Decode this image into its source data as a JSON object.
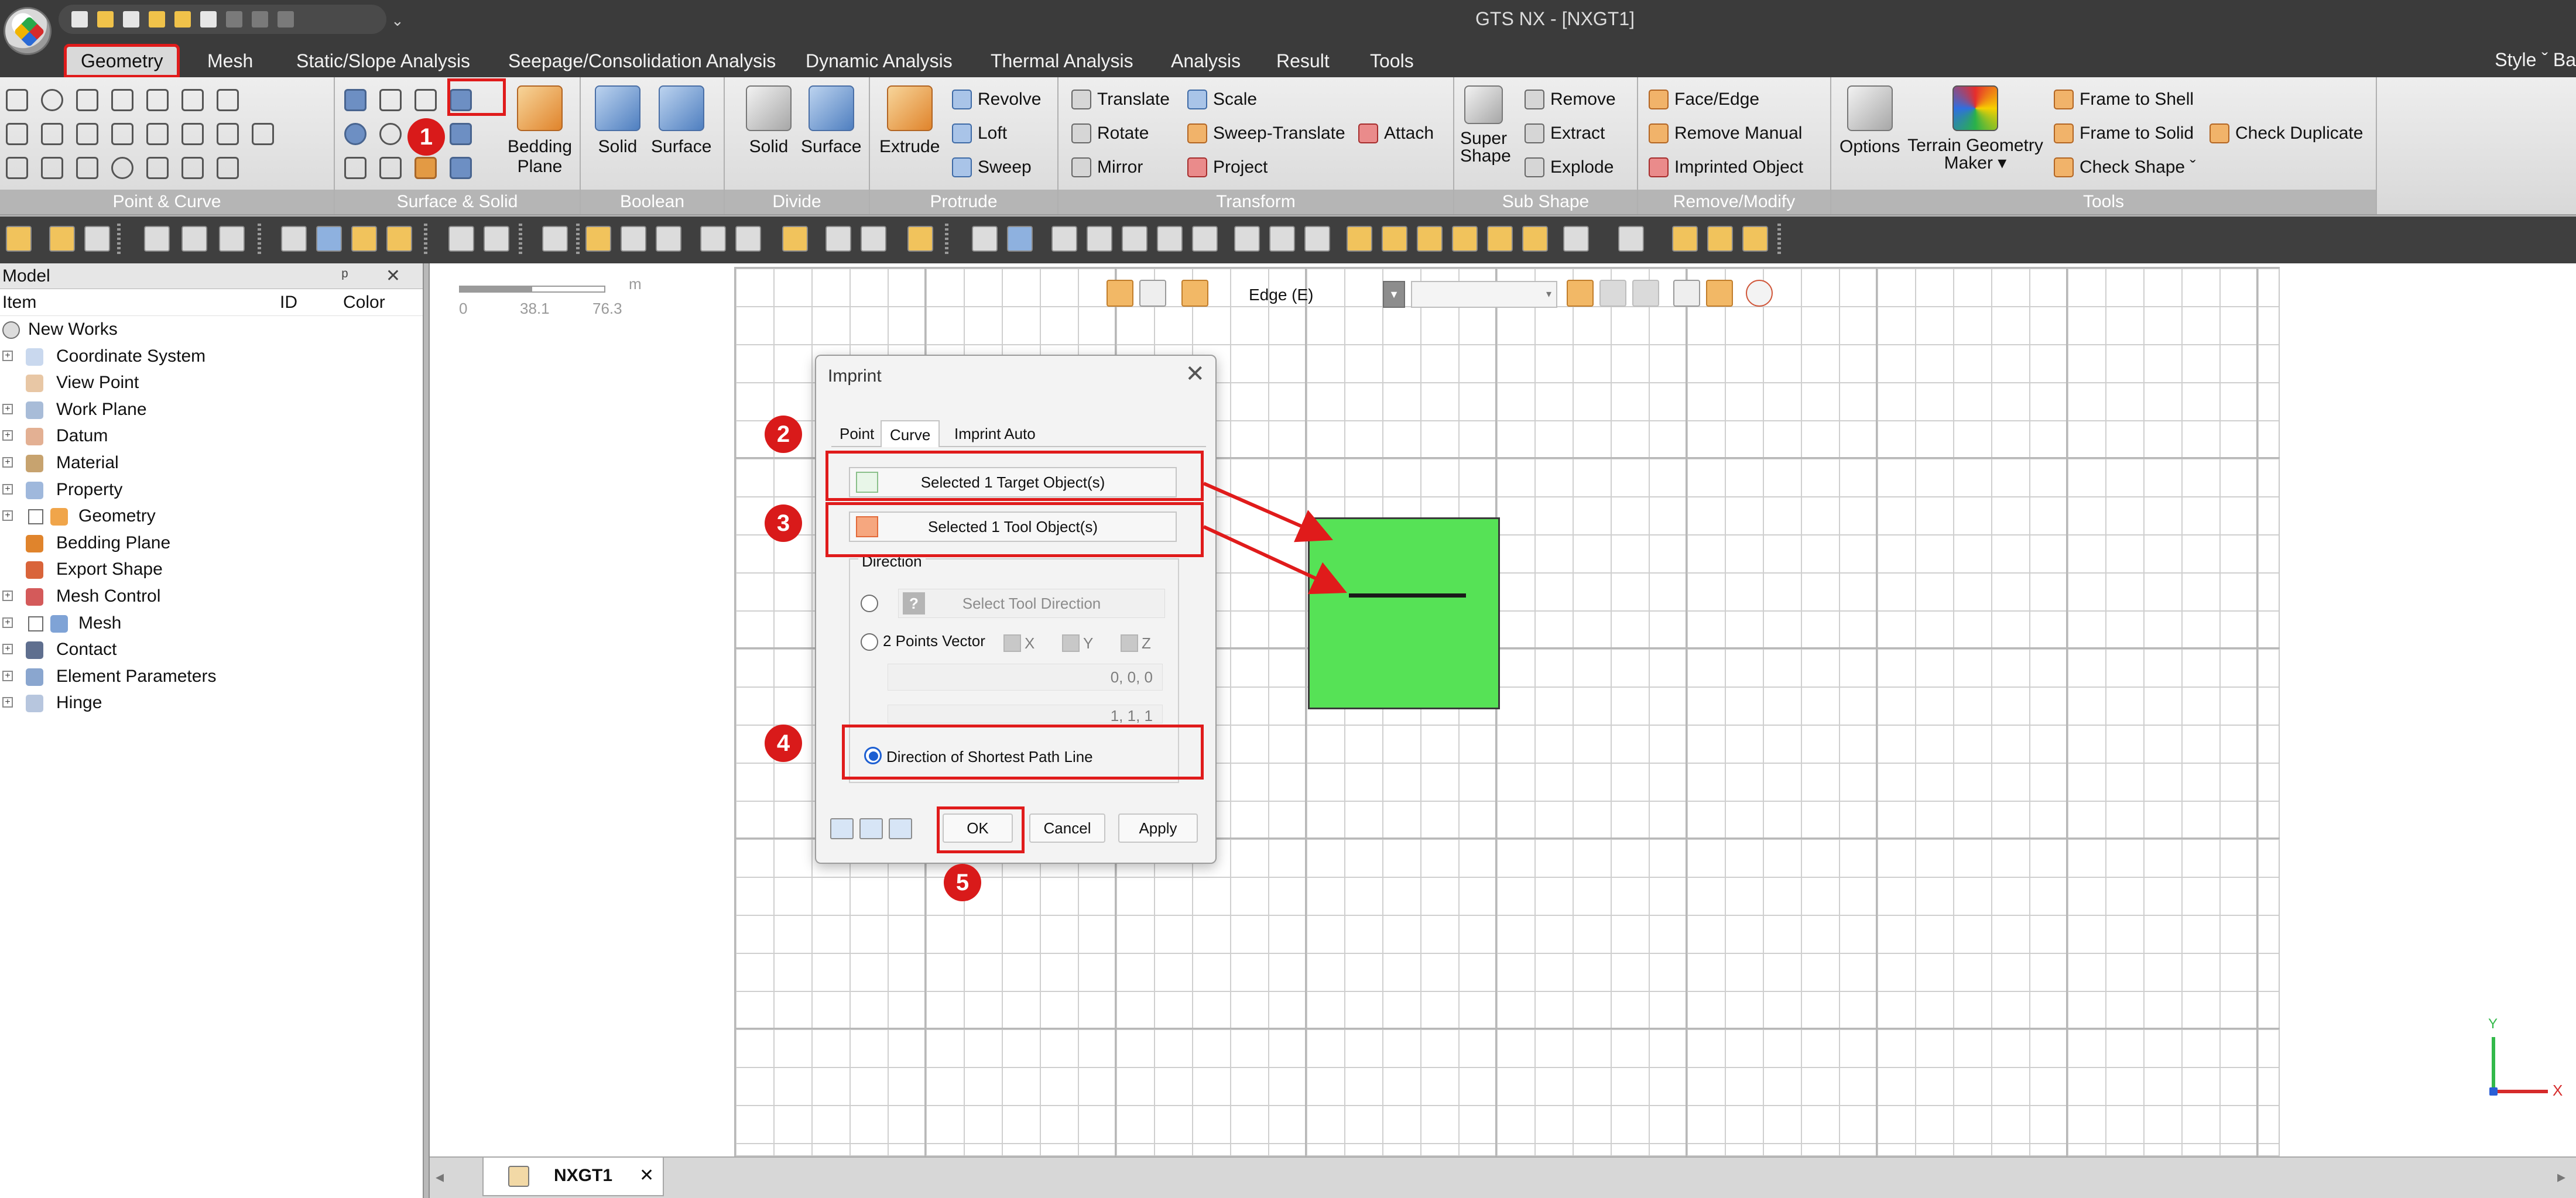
{
  "app": {
    "window_title": "GTS NX - [NXGT1]"
  },
  "menu": {
    "tabs": [
      "Geometry",
      "Mesh",
      "Static/Slope Analysis",
      "Seepage/Consolidation Analysis",
      "Dynamic Analysis",
      "Thermal Analysis",
      "Analysis",
      "Result",
      "Tools"
    ],
    "style_label": "Style ˇ Ba"
  },
  "ribbon": {
    "groups": {
      "point_curve": "Point & Curve",
      "surface_solid": "Surface & Solid",
      "boolean": "Boolean",
      "divide": "Divide",
      "protrude": "Protrude",
      "transform": "Transform",
      "sub_shape": "Sub Shape",
      "remove_modify": "Remove/Modify",
      "tools": "Tools"
    },
    "bedding_plane": "Bedding Plane",
    "boolean": {
      "solid": "Solid",
      "surface": "Surface"
    },
    "divide": {
      "solid": "Solid",
      "surface": "Surface"
    },
    "protrude": {
      "extrude": "Extrude",
      "revolve": "Revolve",
      "loft": "Loft",
      "sweep": "Sweep"
    },
    "transform": {
      "translate": "Translate",
      "rotate": "Rotate",
      "mirror": "Mirror",
      "scale": "Scale",
      "sweep_translate": "Sweep-Translate",
      "project": "Project",
      "attach": "Attach"
    },
    "sub_shape": {
      "super_shape": "Super Shape",
      "remove": "Remove",
      "extract": "Extract",
      "explode": "Explode"
    },
    "remove_modify": {
      "face_edge": "Face/Edge",
      "remove_manual": "Remove Manual",
      "imprinted_object": "Imprinted Object"
    },
    "tools": {
      "options": "Options",
      "terrain_geometry_maker": "Terrain Geometry Maker ▾",
      "frame_to_shell": "Frame to Shell",
      "frame_to_solid": "Frame to Solid",
      "check_shape": "Check Shape ˇ",
      "check_duplicate": "Check Duplicate"
    }
  },
  "model_panel": {
    "title": "Model",
    "controls": "ᵖ ✕",
    "columns": {
      "item": "Item",
      "id": "ID",
      "color": "Color"
    },
    "tree": [
      {
        "label": "New Works"
      },
      {
        "label": "Coordinate System"
      },
      {
        "label": "View Point"
      },
      {
        "label": "Work Plane"
      },
      {
        "label": "Datum"
      },
      {
        "label": "Material"
      },
      {
        "label": "Property"
      },
      {
        "label": "Geometry"
      },
      {
        "label": "Bedding Plane"
      },
      {
        "label": "Export Shape"
      },
      {
        "label": "Mesh Control"
      },
      {
        "label": "Mesh"
      },
      {
        "label": "Contact"
      },
      {
        "label": "Element Parameters"
      },
      {
        "label": "Hinge"
      }
    ]
  },
  "viewport": {
    "scale": {
      "unit": "m",
      "ticks": [
        "0",
        "38.1",
        "76.3"
      ]
    },
    "filter": {
      "selection": "Edge (E)"
    },
    "axis": {
      "x": "X",
      "y": "Y"
    },
    "doc_tab": "NXGT1"
  },
  "dialog": {
    "title": "Imprint",
    "tabs": [
      "Point",
      "Curve",
      "Imprint Auto"
    ],
    "active_tab": "Curve",
    "target_button": "Selected 1 Target Object(s)",
    "tool_button": "Selected 1 Tool Object(s)",
    "direction_label": "Direction",
    "select_tool_direction": "Select Tool Direction",
    "two_points_vector": "2 Points Vector",
    "axes": [
      "X",
      "Y",
      "Z"
    ],
    "vector_value_1": "0, 0, 0",
    "vector_value_2": "1, 1, 1",
    "shortest_path": "Direction of Shortest Path Line",
    "ok": "OK",
    "cancel": "Cancel",
    "apply": "Apply"
  },
  "callouts": [
    "1",
    "2",
    "3",
    "4",
    "5"
  ],
  "colors": {
    "highlight": "#e01b1b",
    "geometry_fill": "#56e256",
    "titlebar": "#3b3b3b"
  }
}
